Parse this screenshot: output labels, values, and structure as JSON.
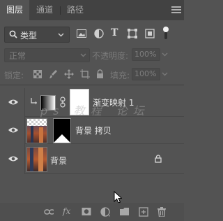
{
  "tabs": [
    {
      "label": "图层",
      "active": true
    },
    {
      "label": "通道",
      "active": false
    },
    {
      "label": "路径",
      "active": false
    }
  ],
  "filter": {
    "kind_label": "类型"
  },
  "blend": {
    "mode": "正常",
    "opacity_label": "不透明度:",
    "opacity_value": "100%"
  },
  "lock": {
    "label": "锁定:",
    "fill_label": "填充:",
    "fill_value": "100%"
  },
  "layers": [
    {
      "name": "渐变映射 1",
      "type": "adjustment"
    },
    {
      "name": "背景 拷贝",
      "type": "pixel-with-mask"
    },
    {
      "name": "背景",
      "type": "background",
      "locked": true
    }
  ],
  "watermark": "ps 教程 论坛",
  "icons": {
    "filter": [
      "image-filter-icon",
      "adjustment-filter-icon",
      "type-filter-icon",
      "shape-filter-icon",
      "smart-object-filter-icon",
      "filter-toggle-icon"
    ],
    "lock": [
      "lock-transparent-icon",
      "lock-paint-icon",
      "lock-move-icon",
      "lock-artboard-icon",
      "lock-all-icon"
    ],
    "bottom": [
      "link-layers-icon",
      "fx-icon",
      "add-mask-icon",
      "new-adjustment-icon",
      "new-group-icon",
      "new-layer-icon",
      "delete-layer-icon"
    ]
  }
}
